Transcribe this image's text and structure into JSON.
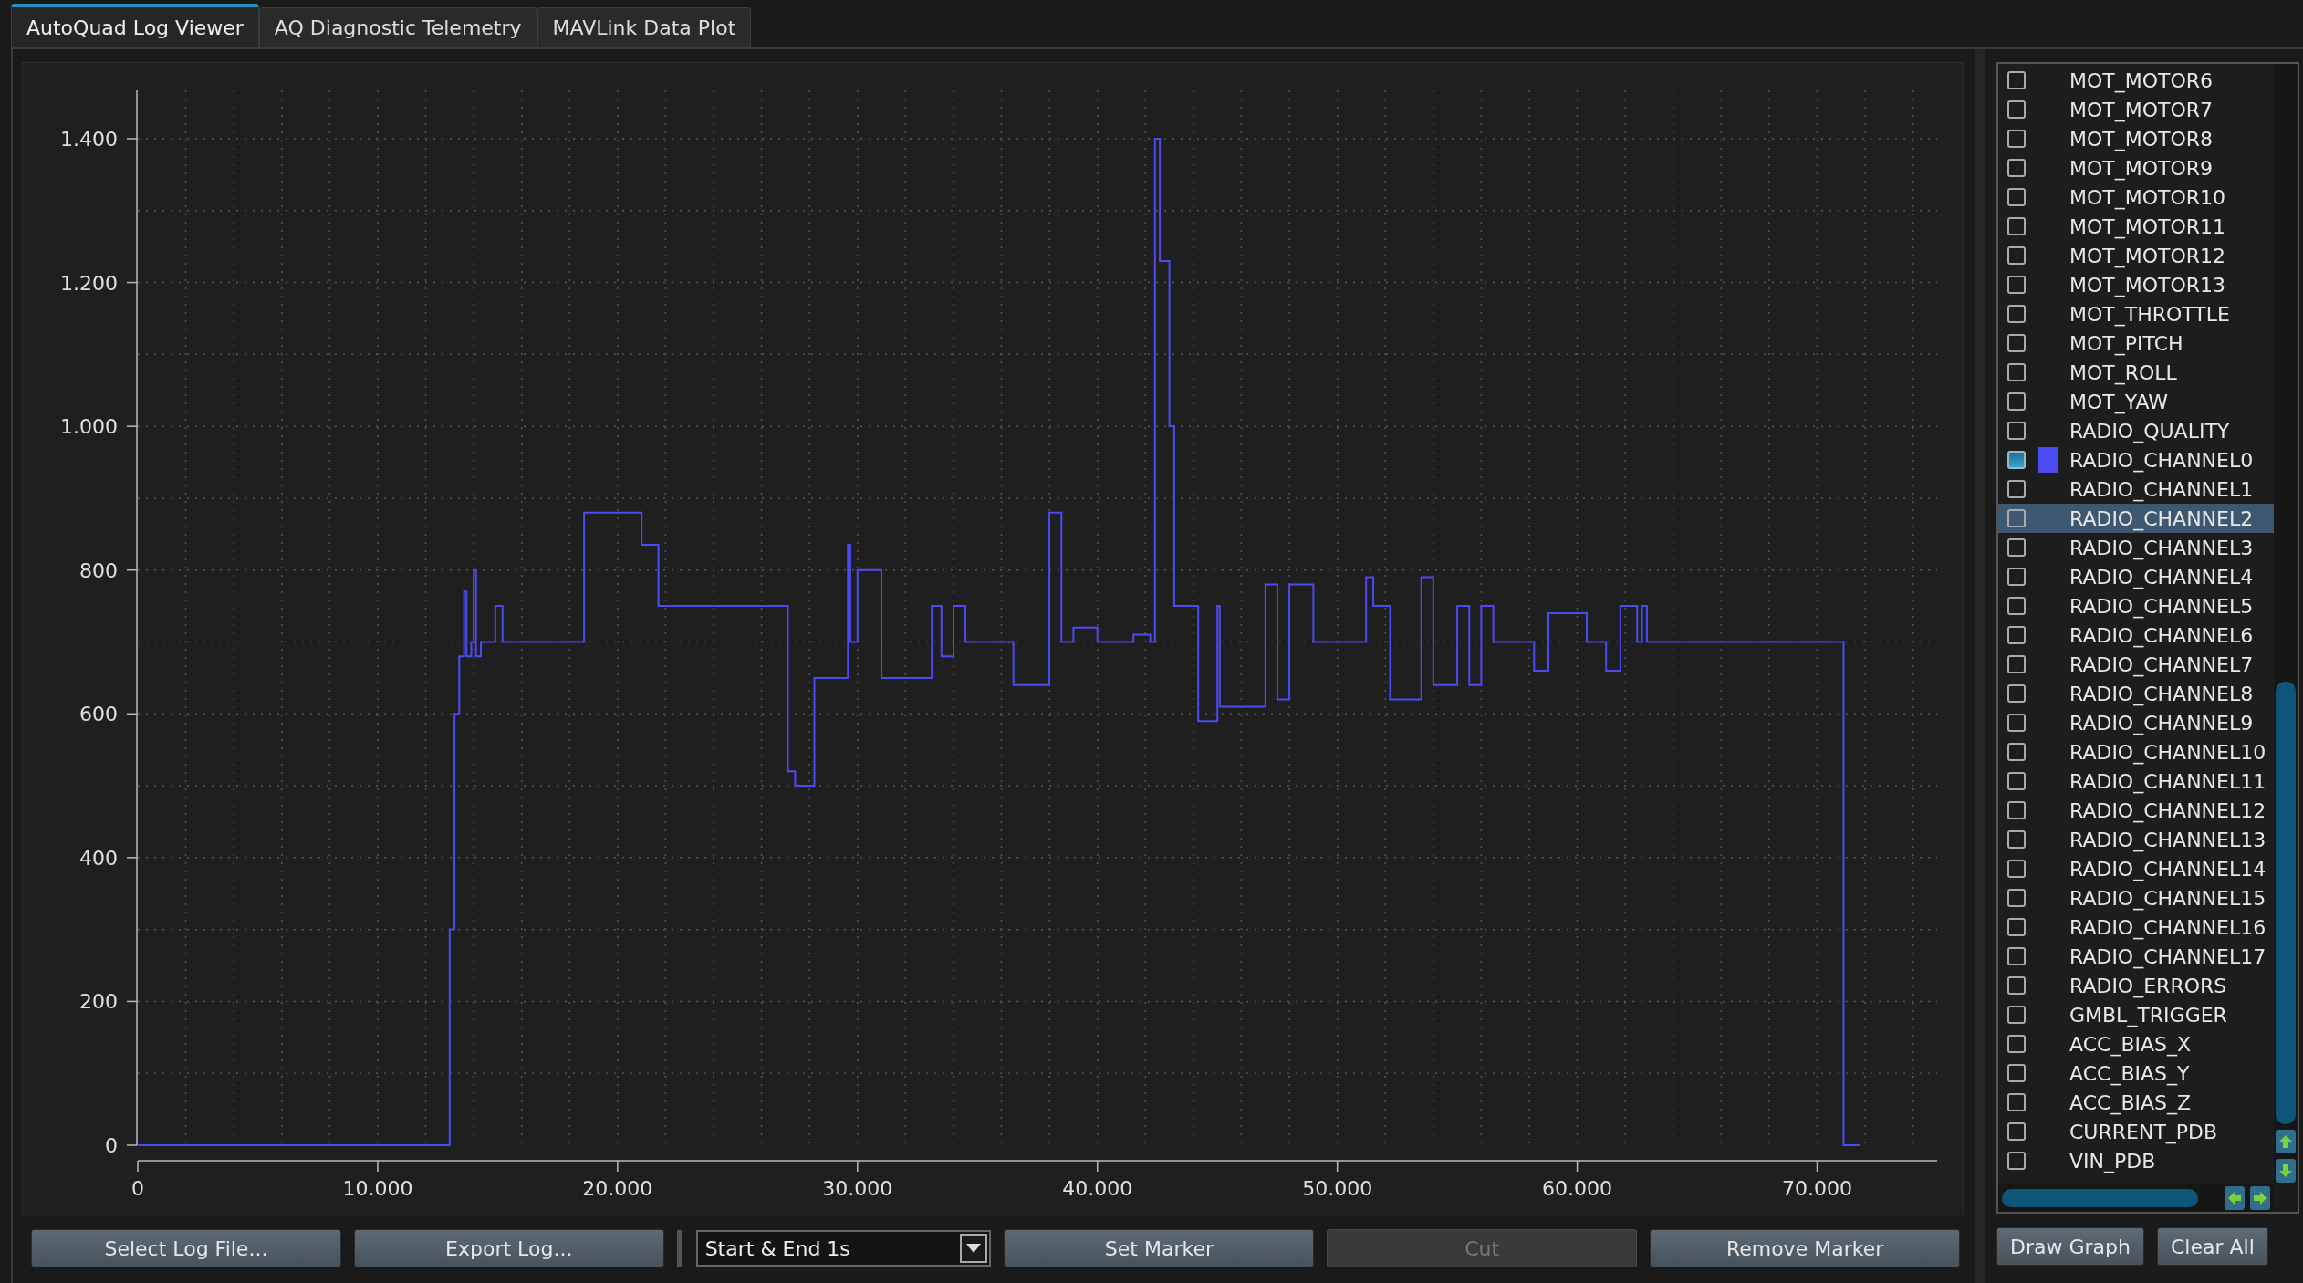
{
  "tabs": [
    {
      "label": "AutoQuad Log Viewer",
      "selected": true
    },
    {
      "label": "AQ Diagnostic Telemetry",
      "selected": false
    },
    {
      "label": "MAVLink Data Plot",
      "selected": false
    }
  ],
  "plot": {
    "chart_data": {
      "type": "line",
      "x": [
        0,
        13000,
        13000,
        13200,
        13200,
        13400,
        13400,
        13600,
        13600,
        13700,
        13700,
        13900,
        13900,
        14000,
        14000,
        14100,
        14100,
        14300,
        14300,
        14900,
        14900,
        15200,
        15200,
        18600,
        18600,
        21000,
        21000,
        21700,
        21700,
        27100,
        27100,
        27400,
        27400,
        28200,
        28200,
        29600,
        29600,
        29700,
        29700,
        30000,
        30000,
        31000,
        31000,
        33100,
        33100,
        33500,
        33500,
        34000,
        34000,
        34500,
        34500,
        36500,
        36500,
        38000,
        38000,
        38500,
        38500,
        39000,
        39000,
        40000,
        40000,
        41500,
        41500,
        42200,
        42200,
        42400,
        42400,
        42600,
        42600,
        43000,
        43000,
        43200,
        43200,
        44200,
        44200,
        45000,
        45000,
        45100,
        45100,
        47000,
        47000,
        47500,
        47500,
        48000,
        48000,
        49000,
        49000,
        51200,
        51200,
        51500,
        51500,
        52200,
        52200,
        53500,
        53500,
        54000,
        54000,
        55000,
        55000,
        55500,
        55500,
        56000,
        56000,
        56500,
        56500,
        58200,
        58200,
        58800,
        58800,
        60400,
        60400,
        61200,
        61200,
        61800,
        61800,
        62500,
        62500,
        62700,
        62700,
        62900,
        62900,
        71100,
        71100,
        71800
      ],
      "series": [
        {
          "color": "#4b4bf5",
          "values": [
            0,
            0,
            300,
            300,
            600,
            600,
            680,
            680,
            770,
            770,
            680,
            680,
            700,
            700,
            800,
            800,
            680,
            680,
            700,
            700,
            750,
            750,
            700,
            700,
            880,
            880,
            835,
            835,
            750,
            750,
            520,
            520,
            500,
            500,
            650,
            650,
            835,
            835,
            700,
            700,
            800,
            800,
            650,
            650,
            750,
            750,
            680,
            680,
            750,
            750,
            700,
            700,
            640,
            640,
            880,
            880,
            700,
            700,
            720,
            720,
            700,
            700,
            710,
            710,
            700,
            700,
            1400,
            1400,
            1230,
            1230,
            1000,
            1000,
            750,
            750,
            590,
            590,
            750,
            750,
            610,
            610,
            780,
            780,
            620,
            620,
            780,
            780,
            700,
            700,
            790,
            790,
            750,
            750,
            620,
            620,
            790,
            790,
            640,
            640,
            750,
            750,
            640,
            640,
            750,
            750,
            700,
            700,
            660,
            660,
            740,
            740,
            700,
            700,
            660,
            660,
            750,
            750,
            700,
            700,
            750,
            750,
            700,
            700,
            0,
            0
          ]
        }
      ],
      "xlim": [
        0,
        75000
      ],
      "ylim": [
        0,
        1400
      ],
      "grid": true,
      "xticks": [
        {
          "value": 0,
          "label": "0"
        },
        {
          "value": 10000,
          "label": "10.000"
        },
        {
          "value": 20000,
          "label": "20.000"
        },
        {
          "value": 30000,
          "label": "30.000"
        },
        {
          "value": 40000,
          "label": "40.000"
        },
        {
          "value": 50000,
          "label": "50.000"
        },
        {
          "value": 60000,
          "label": "60.000"
        },
        {
          "value": 70000,
          "label": "70.000"
        }
      ],
      "yticks": [
        {
          "value": 0,
          "label": "0"
        },
        {
          "value": 200,
          "label": "200"
        },
        {
          "value": 400,
          "label": "400"
        },
        {
          "value": 600,
          "label": "600"
        },
        {
          "value": 800,
          "label": "800"
        },
        {
          "value": 1000,
          "label": "1.000"
        },
        {
          "value": 1200,
          "label": "1.200"
        },
        {
          "value": 1400,
          "label": "1.400"
        }
      ]
    }
  },
  "toolbar": [
    {
      "kind": "button",
      "label": "Select Log File...",
      "disabled": false
    },
    {
      "kind": "button",
      "label": "Export Log...",
      "disabled": false
    },
    {
      "kind": "combo",
      "value": "Start & End 1s"
    },
    {
      "kind": "button",
      "label": "Set Marker",
      "disabled": false
    },
    {
      "kind": "button",
      "label": "Cut",
      "disabled": true
    },
    {
      "kind": "button",
      "label": "Remove Marker",
      "disabled": false
    }
  ],
  "channels": [
    {
      "label": "MOT_MOTOR6",
      "checked": false,
      "selected": false
    },
    {
      "label": "MOT_MOTOR7",
      "checked": false,
      "selected": false
    },
    {
      "label": "MOT_MOTOR8",
      "checked": false,
      "selected": false
    },
    {
      "label": "MOT_MOTOR9",
      "checked": false,
      "selected": false
    },
    {
      "label": "MOT_MOTOR10",
      "checked": false,
      "selected": false
    },
    {
      "label": "MOT_MOTOR11",
      "checked": false,
      "selected": false
    },
    {
      "label": "MOT_MOTOR12",
      "checked": false,
      "selected": false
    },
    {
      "label": "MOT_MOTOR13",
      "checked": false,
      "selected": false
    },
    {
      "label": "MOT_THROTTLE",
      "checked": false,
      "selected": false
    },
    {
      "label": "MOT_PITCH",
      "checked": false,
      "selected": false
    },
    {
      "label": "MOT_ROLL",
      "checked": false,
      "selected": false
    },
    {
      "label": "MOT_YAW",
      "checked": false,
      "selected": false
    },
    {
      "label": "RADIO_QUALITY",
      "checked": false,
      "selected": false
    },
    {
      "label": "RADIO_CHANNEL0",
      "checked": true,
      "selected": false,
      "color": "#4b4bf5"
    },
    {
      "label": "RADIO_CHANNEL1",
      "checked": false,
      "selected": false
    },
    {
      "label": "RADIO_CHANNEL2",
      "checked": false,
      "selected": true
    },
    {
      "label": "RADIO_CHANNEL3",
      "checked": false,
      "selected": false
    },
    {
      "label": "RADIO_CHANNEL4",
      "checked": false,
      "selected": false
    },
    {
      "label": "RADIO_CHANNEL5",
      "checked": false,
      "selected": false
    },
    {
      "label": "RADIO_CHANNEL6",
      "checked": false,
      "selected": false
    },
    {
      "label": "RADIO_CHANNEL7",
      "checked": false,
      "selected": false
    },
    {
      "label": "RADIO_CHANNEL8",
      "checked": false,
      "selected": false
    },
    {
      "label": "RADIO_CHANNEL9",
      "checked": false,
      "selected": false
    },
    {
      "label": "RADIO_CHANNEL10",
      "checked": false,
      "selected": false
    },
    {
      "label": "RADIO_CHANNEL11",
      "checked": false,
      "selected": false
    },
    {
      "label": "RADIO_CHANNEL12",
      "checked": false,
      "selected": false
    },
    {
      "label": "RADIO_CHANNEL13",
      "checked": false,
      "selected": false
    },
    {
      "label": "RADIO_CHANNEL14",
      "checked": false,
      "selected": false
    },
    {
      "label": "RADIO_CHANNEL15",
      "checked": false,
      "selected": false
    },
    {
      "label": "RADIO_CHANNEL16",
      "checked": false,
      "selected": false
    },
    {
      "label": "RADIO_CHANNEL17",
      "checked": false,
      "selected": false
    },
    {
      "label": "RADIO_ERRORS",
      "checked": false,
      "selected": false
    },
    {
      "label": "GMBL_TRIGGER",
      "checked": false,
      "selected": false
    },
    {
      "label": "ACC_BIAS_X",
      "checked": false,
      "selected": false
    },
    {
      "label": "ACC_BIAS_Y",
      "checked": false,
      "selected": false
    },
    {
      "label": "ACC_BIAS_Z",
      "checked": false,
      "selected": false
    },
    {
      "label": "CURRENT_PDB",
      "checked": false,
      "selected": false
    },
    {
      "label": "VIN_PDB",
      "checked": false,
      "selected": false
    }
  ],
  "side_buttons": [
    "Draw Graph",
    "Clear All"
  ]
}
